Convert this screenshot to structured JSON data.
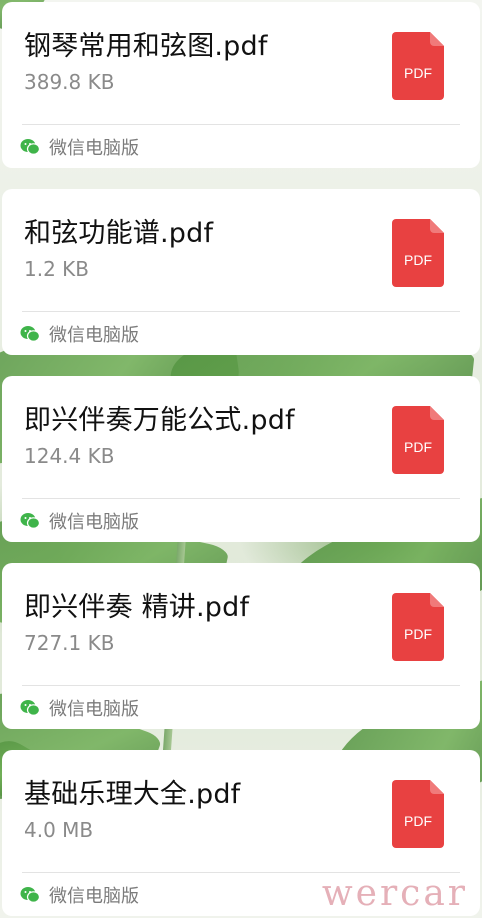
{
  "files": [
    {
      "name": "钢琴常用和弦图.pdf",
      "size": "389.8 KB",
      "type_icon": "pdf-icon",
      "icon_label": "PDF",
      "source": "微信电脑版"
    },
    {
      "name": "和弦功能谱.pdf",
      "size": "1.2 KB",
      "type_icon": "pdf-icon",
      "icon_label": "PDF",
      "source": "微信电脑版"
    },
    {
      "name": "即兴伴奏万能公式.pdf",
      "size": "124.4 KB",
      "type_icon": "pdf-icon",
      "icon_label": "PDF",
      "source": "微信电脑版"
    },
    {
      "name": "即兴伴奏 精讲.pdf",
      "size": "727.1 KB",
      "type_icon": "pdf-icon",
      "icon_label": "PDF",
      "source": "微信电脑版"
    },
    {
      "name": "基础乐理大全.pdf",
      "size": "4.0 MB",
      "type_icon": "pdf-icon",
      "icon_label": "PDF",
      "source": "微信电脑版"
    }
  ],
  "colors": {
    "pdf_red": "#e84141",
    "pdf_fold": "#f07a7a",
    "wechat_green": "#3fb44a",
    "card_background": "#ffffff",
    "watermark": "#dc96a0"
  },
  "watermark": "wercar"
}
